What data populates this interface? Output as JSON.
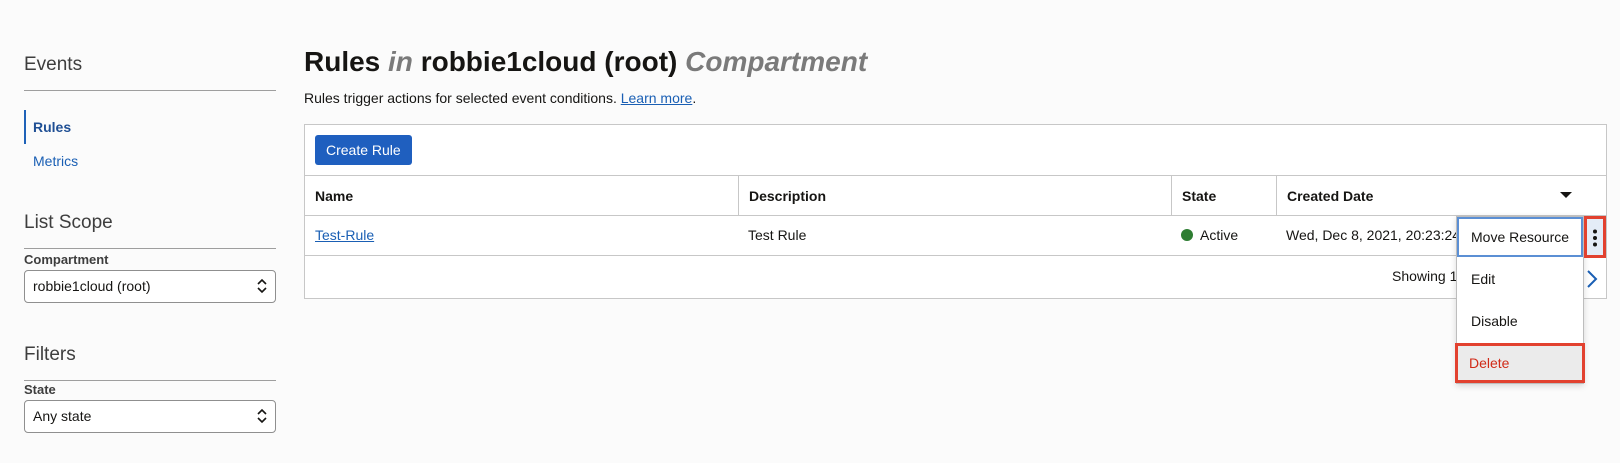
{
  "sidebar": {
    "heading": "Events",
    "nav": [
      {
        "label": "Rules",
        "active": true
      },
      {
        "label": "Metrics",
        "active": false
      }
    ],
    "list_scope_heading": "List Scope",
    "compartment_label": "Compartment",
    "compartment_value": "robbie1cloud (root)",
    "filters_heading": "Filters",
    "state_label": "State",
    "state_value": "Any state"
  },
  "header": {
    "title_main": "Rules",
    "title_in": "in",
    "title_compartment": "robbie1cloud (root)",
    "title_suffix": "Compartment",
    "subtitle_text": "Rules trigger actions for selected event conditions.",
    "subtitle_link": "Learn more",
    "subtitle_period": "."
  },
  "toolbar": {
    "create_label": "Create Rule"
  },
  "table": {
    "columns": [
      "Name",
      "Description",
      "State",
      "Created Date"
    ],
    "rows": [
      {
        "name": "Test-Rule",
        "description": "Test Rule",
        "state": "Active",
        "created": "Wed, Dec 8, 2021, 20:23:24"
      }
    ],
    "footer_text": "Showing 1"
  },
  "menu": {
    "items": [
      "Move Resource",
      "Edit",
      "Disable",
      "Delete"
    ]
  },
  "colors": {
    "primary": "#1f5fbf",
    "link": "#1a5fb4",
    "active_state": "#2e7d32",
    "highlight": "#e2412f",
    "danger_text": "#d12a17"
  }
}
